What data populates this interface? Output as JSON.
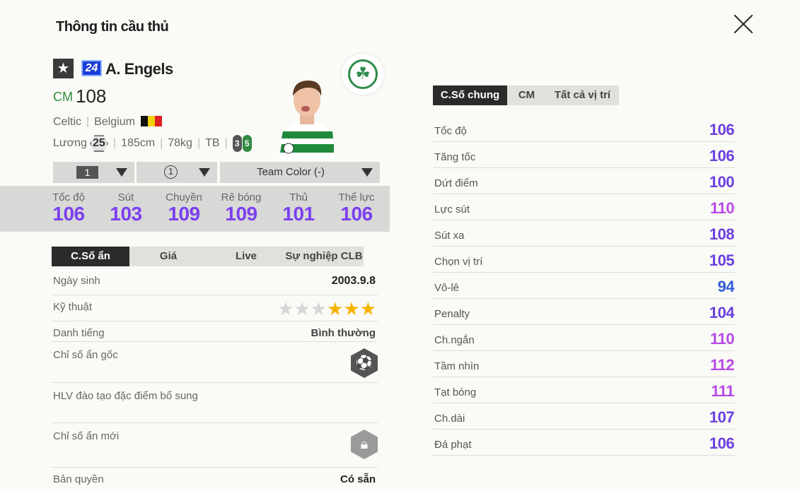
{
  "header": {
    "title": "Thông tin cầu thủ",
    "close_icon": "close-icon"
  },
  "player": {
    "star_icon": "★",
    "season": "24",
    "name": "A. Engels",
    "position": "CM",
    "ovr": "108",
    "club": "Celtic",
    "nation": "Belgium",
    "salary_label": "Lương",
    "salary": "25",
    "height": "185cm",
    "weight": "78kg",
    "body": "TB",
    "weak_foot": "3",
    "strong_foot": "5"
  },
  "selectors": {
    "level": "1",
    "grade": "1",
    "team_color": "Team Color (-)"
  },
  "summary_stats": [
    {
      "label": "Tốc độ",
      "value": "106"
    },
    {
      "label": "Sút",
      "value": "103"
    },
    {
      "label": "Chuyền",
      "value": "109"
    },
    {
      "label": "Rê bóng",
      "value": "109"
    },
    {
      "label": "Thủ",
      "value": "101"
    },
    {
      "label": "Thể lực",
      "value": "106"
    }
  ],
  "left_tabs": [
    "C.Số ẩn",
    "Giá",
    "Live",
    "Sự nghiệp CLB"
  ],
  "details": {
    "birth_label": "Ngày sinh",
    "birth": "2003.9.8",
    "skill_label": "Kỹ thuật",
    "skill_stars": 3,
    "skill_max": 6,
    "fame_label": "Danh tiếng",
    "fame": "Bình thường",
    "orig_trait_label": "Chỉ số ẩn gốc",
    "coach_label": "HLV đào tạo đặc điểm bổ sung",
    "new_trait_label": "Chỉ số ẩn mới",
    "license_label": "Bản quyền",
    "license": "Có sẵn"
  },
  "right_tabs": [
    "C.Số chung",
    "CM",
    "Tất cả vị trí"
  ],
  "stats": [
    {
      "label": "Tốc độ",
      "value": "106",
      "color": "#6a3fe0"
    },
    {
      "label": "Tăng tốc",
      "value": "106",
      "color": "#6a3fe0"
    },
    {
      "label": "Dứt điểm",
      "value": "100",
      "color": "#6a3fe0"
    },
    {
      "label": "Lực sút",
      "value": "110",
      "color": "#b64ae6"
    },
    {
      "label": "Sút xa",
      "value": "108",
      "color": "#6a3fe0"
    },
    {
      "label": "Chọn vị trí",
      "value": "105",
      "color": "#6a3fe0"
    },
    {
      "label": "Vô-lê",
      "value": "94",
      "color": "#2f5ad8"
    },
    {
      "label": "Penalty",
      "value": "104",
      "color": "#6a3fe0"
    },
    {
      "label": "Ch.ngắn",
      "value": "110",
      "color": "#b64ae6"
    },
    {
      "label": "Tầm nhìn",
      "value": "112",
      "color": "#b64ae6"
    },
    {
      "label": "Tạt bóng",
      "value": "111",
      "color": "#b64ae6"
    },
    {
      "label": "Ch.dài",
      "value": "107",
      "color": "#6a3fe0"
    },
    {
      "label": "Đá phạt",
      "value": "106",
      "color": "#6a3fe0"
    }
  ]
}
